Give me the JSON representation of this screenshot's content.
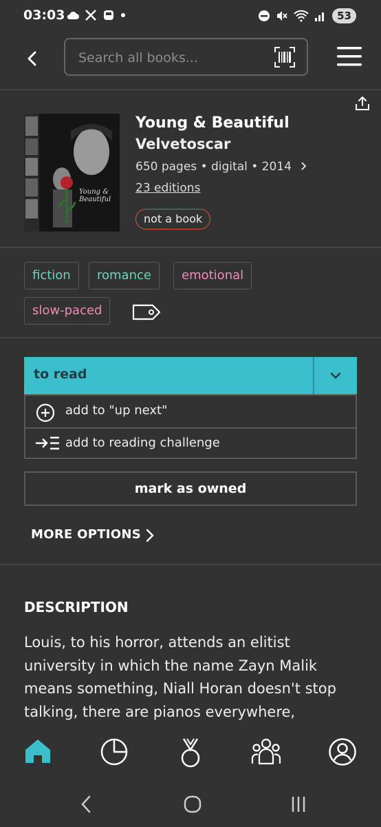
{
  "status": {
    "time": "03:03",
    "battery": "53"
  },
  "search": {
    "placeholder": "Search all books..."
  },
  "book": {
    "title": "Young & Beautiful",
    "author": "Velvetoscar",
    "meta": "650 pages • digital • 2014",
    "editions": "23 editions",
    "not_a_book": "not a book",
    "cover_text": "Young & Beautiful"
  },
  "tags": [
    {
      "label": "fiction",
      "color": "#6ad6b8"
    },
    {
      "label": "romance",
      "color": "#6ad6b8"
    },
    {
      "label": "emotional",
      "color": "#f28bb7"
    },
    {
      "label": "slow-paced",
      "color": "#f28bb7"
    }
  ],
  "actions": {
    "to_read": "to read",
    "add_up_next": "add to \"up next\"",
    "add_challenge": "add to reading challenge",
    "mark_owned": "mark as owned",
    "more_options": "MORE OPTIONS"
  },
  "description": {
    "heading": "DESCRIPTION",
    "text": "Louis, to his horror, attends an elitist university in which the name Zayn Malik means something, Niall Horan doesn't stop talking, there are pianos everywhere,"
  },
  "colors": {
    "accent": "#3cbfcc",
    "background": "#323232",
    "tag_green": "#6ad6b8",
    "tag_pink": "#f28bb7",
    "not_book_border": "#d9534f"
  },
  "nav": [
    "home-icon",
    "stats-icon",
    "challenges-icon",
    "community-icon",
    "profile-icon"
  ]
}
